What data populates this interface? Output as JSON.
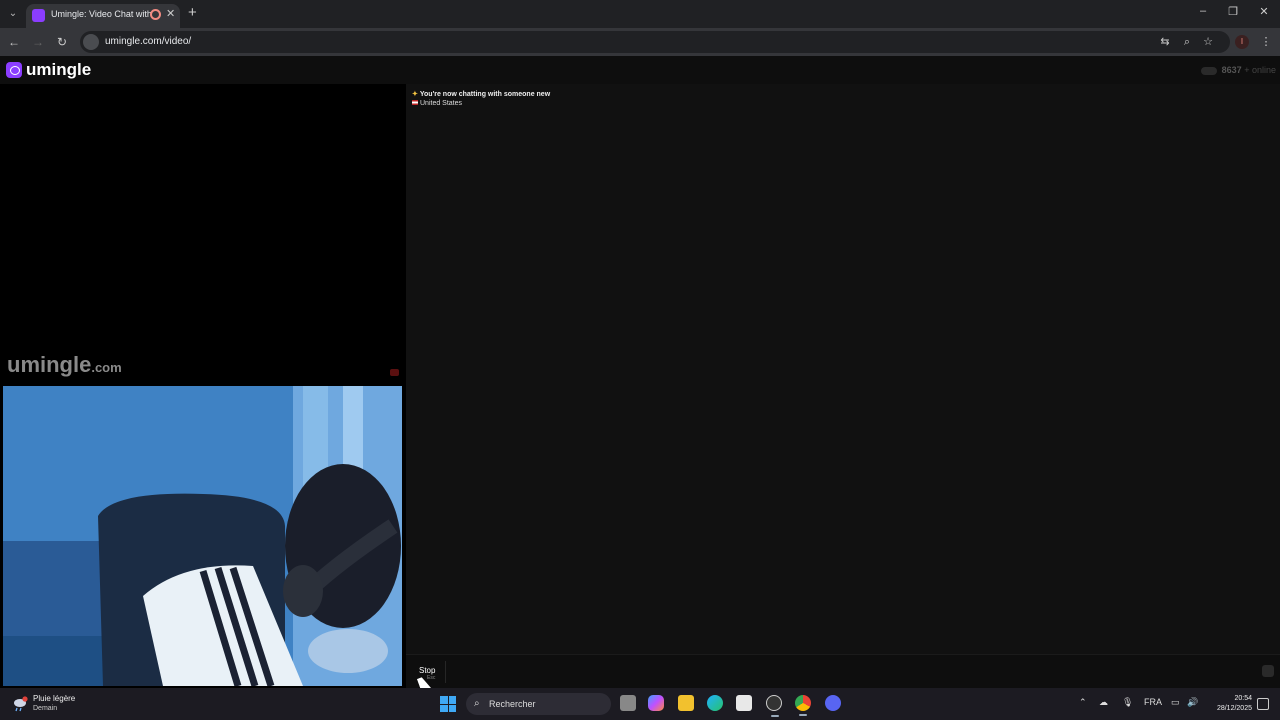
{
  "browser": {
    "tab_title": "Umingle: Video Chat with S",
    "tab_close": "✕",
    "new_tab": "+",
    "url": "umingle.com/video/",
    "window_controls": {
      "minimize": "–",
      "restore": "❐",
      "close": "✕"
    },
    "profile_initial": "I",
    "icons": [
      "tab-list-icon",
      "back-icon",
      "forward-icon",
      "reload-icon",
      "site-info-icon",
      "translate-icon",
      "zoom-icon",
      "bookmark-star-icon",
      "menu-icon"
    ]
  },
  "site": {
    "logo": "umingle",
    "online_count": "8637",
    "online_label": "online",
    "watermark": "umingle",
    "watermark_suffix": ".com"
  },
  "chat": {
    "system_message": "You're now chatting with someone new",
    "country": "United States",
    "stop_label": "Stop",
    "stop_hint": "Esc"
  },
  "taskbar": {
    "weather_condition": "Pluie légère",
    "weather_when": "Demain",
    "search_placeholder": "Rechercher",
    "language": "FRA",
    "time": "20:54",
    "date": "28/12/2025",
    "apps": [
      "windows-start-icon",
      "task-view-icon",
      "copilot-icon",
      "file-explorer-icon",
      "edge-icon",
      "store-icon",
      "vpn-icon",
      "chrome-icon",
      "discord-icon"
    ]
  },
  "colors": {
    "brand": "#8b3dff",
    "chat_bg": "#111111",
    "taskbar_bg": "#1c1b22"
  }
}
